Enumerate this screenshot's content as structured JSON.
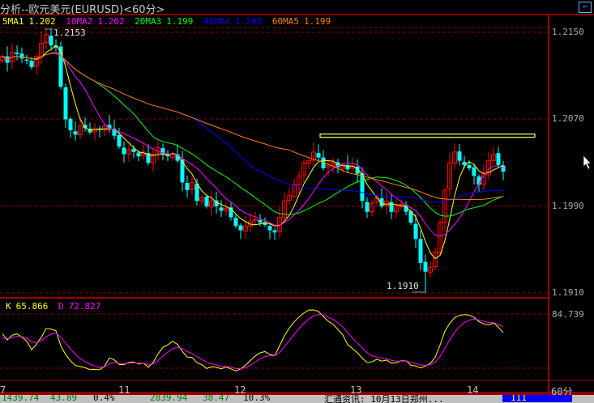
{
  "window": {
    "title": "分析--欧元美元(EURUSD)<60分>",
    "back_icon": "arrow-left-icon"
  },
  "ma_legend": [
    {
      "label": "5MA1",
      "value": "1.202",
      "color": "#ffff00",
      "period": 5
    },
    {
      "label": "10MA2",
      "value": "1.202",
      "color": "#ff00ff",
      "period": 10
    },
    {
      "label": "20MA3",
      "value": "1.199",
      "color": "#00ff00",
      "period": 20
    },
    {
      "label": "40MA4",
      "value": "1.200",
      "color": "#0000ff",
      "period": 40
    },
    {
      "label": "60MA5",
      "value": "1.199",
      "color": "#ff8000",
      "period": 60
    }
  ],
  "price_axis": [
    "1.2150",
    "1.2070",
    "1.1990",
    "1.1910"
  ],
  "annotations": {
    "high": "1.2153",
    "low": "1.1910"
  },
  "kd": {
    "k_label": "K",
    "k_value": "65.866",
    "d_label": "D",
    "d_value": "72.827",
    "axis_label": "84.739"
  },
  "dates": [
    "7",
    "11",
    "12",
    "13",
    "14"
  ],
  "period_label": "60分",
  "status_bar": [
    "1439.74",
    "43.89",
    "0.4%",
    "2839.94",
    "38.47",
    "10.3%",
    "汇通资讯: 10月13日郑州...",
    "111"
  ],
  "chart_data": {
    "type": "candlestick",
    "title": "欧元美元(EURUSD) 60分",
    "ylim": [
      1.1905,
      1.216
    ],
    "high": 1.2153,
    "low": 1.191,
    "close": [
      1.2128,
      1.2122,
      1.2132,
      1.213,
      1.2126,
      1.2124,
      1.2118,
      1.2128,
      1.214,
      1.2148,
      1.2138,
      1.2136,
      1.21,
      1.207,
      1.206,
      1.2056,
      1.2064,
      1.2062,
      1.2058,
      1.2062,
      1.206,
      1.2064,
      1.2062,
      1.2055,
      1.2045,
      1.2038,
      1.2042,
      1.204,
      1.2036,
      1.204,
      1.203,
      1.2038,
      1.2044,
      1.2038,
      1.2036,
      1.2038,
      1.2032,
      1.2012,
      1.2005,
      1.2012,
      1.1995,
      1.1998,
      1.199,
      1.1995,
      1.199,
      1.1986,
      1.1988,
      1.198,
      1.1972,
      1.1968,
      1.1972,
      1.1976,
      1.1978,
      1.1975,
      1.1973,
      1.1968,
      1.1966,
      1.198,
      1.1995,
      1.2,
      1.201,
      1.2018,
      1.203,
      1.2032,
      1.204,
      1.2035,
      1.2025,
      1.2028,
      1.203,
      1.2026,
      1.2028,
      1.2024,
      1.2027,
      1.202,
      1.1995,
      1.1985,
      1.1993,
      1.1998,
      1.199,
      1.1995,
      1.1985,
      1.199,
      1.1992,
      1.1985,
      1.1975,
      1.196,
      1.1938,
      1.193,
      1.1934,
      1.1948,
      1.1975,
      1.2005,
      1.203,
      1.204,
      1.2032,
      1.2028,
      1.2025,
      1.2018,
      1.201,
      1.202,
      1.2032,
      1.2038,
      1.2028,
      1.2022
    ],
    "resistance_line": 1.2055,
    "up_color": "#ff0000",
    "down_color": "#00ffff"
  }
}
